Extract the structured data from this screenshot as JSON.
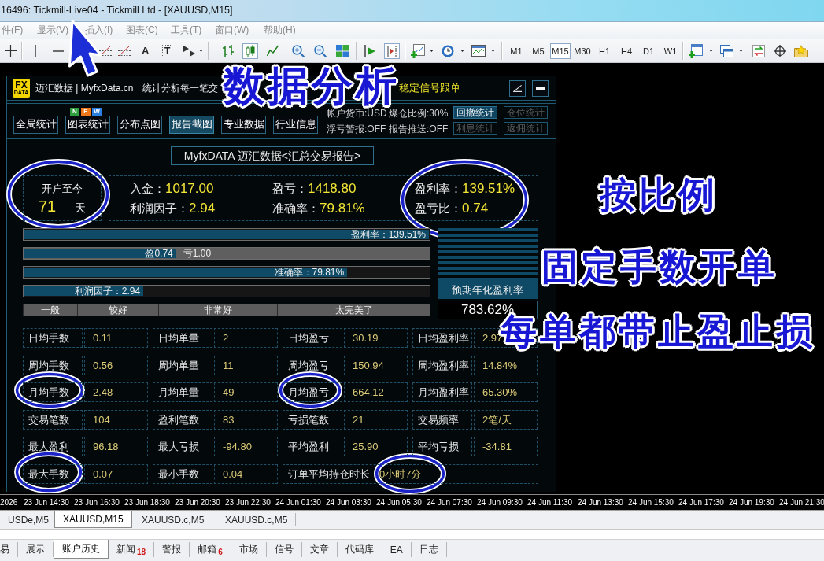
{
  "window": {
    "title": "16496: Tickmill-Live04 - Tickmill Ltd - [XAUUSD,M15]"
  },
  "menu": [
    {
      "label": "件(F)",
      "disabled": true
    },
    {
      "label": "显示(V)",
      "disabled": true
    },
    {
      "label": "插入(I)",
      "disabled": true
    },
    {
      "label": "图表(C)",
      "disabled": true
    },
    {
      "label": "工具(T)",
      "disabled": true
    },
    {
      "label": "窗口(W)",
      "disabled": true
    },
    {
      "label": "帮助(H)",
      "disabled": true
    }
  ],
  "toolbar": {
    "text_tool": "A",
    "label_tool": "T",
    "candlestick_on": true,
    "chart_shift_on": true,
    "timeframes": [
      {
        "label": "M1",
        "selected": false
      },
      {
        "label": "M5",
        "selected": false
      },
      {
        "label": "M15",
        "selected": true
      },
      {
        "label": "M30",
        "selected": false
      },
      {
        "label": "H1",
        "selected": false
      },
      {
        "label": "H4",
        "selected": false
      },
      {
        "label": "D1",
        "selected": false
      },
      {
        "label": "W1",
        "selected": false
      }
    ]
  },
  "panel": {
    "logo": {
      "top": "FX",
      "bottom": "DATA"
    },
    "brand": "迈汇数据 | MyfxData.cn",
    "tagline": "统计分析每一笔交",
    "signal_link": "稳定信号跟单",
    "nav_buttons": [
      {
        "label": "全局统计",
        "selected": false
      },
      {
        "label": "图表统计",
        "selected": false,
        "badge": [
          {
            "letter": "N",
            "color": "#2e9e3e"
          },
          {
            "letter": "E",
            "color": "#f07818"
          },
          {
            "letter": "W",
            "color": "#2b7fe0"
          }
        ]
      },
      {
        "label": "分布点图",
        "selected": false
      },
      {
        "label": "报告截图",
        "selected": true
      },
      {
        "label": "专业数据",
        "selected": false
      },
      {
        "label": "行业信息",
        "selected": false
      }
    ],
    "account_info": [
      "帐户货币:USD",
      "爆仓比例:30%",
      "浮亏警报:OFF",
      "报告推送:OFF"
    ],
    "side_buttons": [
      {
        "label": "回撤统计",
        "disabled": false
      },
      {
        "label": "仓位统计",
        "disabled": true
      },
      {
        "label": "利息统计",
        "disabled": true
      },
      {
        "label": "返佣统计",
        "disabled": true
      }
    ],
    "report_title": "MyfxDATA 迈汇数据<汇总交易报告>",
    "since_open": {
      "label": "开户至今",
      "value": "71",
      "unit": "天"
    },
    "summary": [
      {
        "label": "入金：",
        "value": "1017.00"
      },
      {
        "label": "盈亏：",
        "value": "1418.80"
      },
      {
        "label": "盈利率：",
        "value": "139.51%"
      },
      {
        "label": "利润因子：",
        "value": "2.94"
      },
      {
        "label": "准确率：",
        "value": "79.81%"
      },
      {
        "label": "盈亏比：",
        "value": "0.74"
      }
    ],
    "bars": [
      {
        "kind": "single",
        "label": "盈利率：139.51%",
        "level": 1
      },
      {
        "kind": "split",
        "label": "盈0.74",
        "rest_label": "亏1.00",
        "level": 0.375
      },
      {
        "kind": "single",
        "label": "准确率：79.81%",
        "level": 0.7981
      },
      {
        "kind": "single",
        "label": "利润因子：2.94",
        "level": 0.294
      }
    ],
    "rating_scale": [
      "一般",
      "较好",
      "非常好",
      "太完美了"
    ],
    "annual": {
      "label": "预期年化盈利率",
      "value": "783.62%"
    },
    "stats": [
      [
        {
          "label": "日均手数",
          "value": "0.11"
        },
        {
          "label": "日均单量",
          "value": "2"
        },
        {
          "label": "日均盈亏",
          "value": "30.19"
        },
        {
          "label": "日均盈利率",
          "value": "2.97"
        }
      ],
      [
        {
          "label": "周均手数",
          "value": "0.56"
        },
        {
          "label": "周均单量",
          "value": "11"
        },
        {
          "label": "周均盈亏",
          "value": "150.94"
        },
        {
          "label": "周均盈利率",
          "value": "14.84%"
        }
      ],
      [
        {
          "label": "月均手数",
          "value": "2.48"
        },
        {
          "label": "月均单量",
          "value": "49"
        },
        {
          "label": "月均盈亏",
          "value": "664.12"
        },
        {
          "label": "月均盈利率",
          "value": "65.30%"
        }
      ],
      [
        {
          "label": "交易笔数",
          "value": "104"
        },
        {
          "label": "盈利笔数",
          "value": "83"
        },
        {
          "label": "亏损笔数",
          "value": "21"
        },
        {
          "label": "交易频率",
          "value": "2笔/天"
        }
      ],
      [
        {
          "label": "最大盈利",
          "value": "96.18"
        },
        {
          "label": "最大亏损",
          "value": "-94.80"
        },
        {
          "label": "平均盈利",
          "value": "25.90"
        },
        {
          "label": "平均亏损",
          "value": "-34.81"
        }
      ],
      [
        {
          "label": "最大手数",
          "value": "0.07"
        },
        {
          "label": "最小手数",
          "value": "0.04"
        },
        {
          "label": "订单平均持仓时长",
          "value": "0小时7分"
        }
      ]
    ]
  },
  "annotations": {
    "headline": "数据分析",
    "notes": [
      "按比例",
      "固定手数开单",
      "每单都带止盈止损"
    ]
  },
  "time_axis": [
    "2026",
    "23 Jun 14:30",
    "23 Jun 16:30",
    "23 Jun 18:30",
    "23 Jun 20:30",
    "23 Jun 22:30",
    "24 Jun 01:30",
    "24 Jun 03:30",
    "24 Jun 05:30",
    "24 Jun 07:30",
    "24 Jun 09:30",
    "24 Jun 11:30",
    "24 Jun 13:30",
    "24 Jun 15:30",
    "24 Jun 17:30",
    "24 Jun 19:30",
    "24 Jun 21:30"
  ],
  "chart_tabs": [
    {
      "label": "USDe,M5",
      "selected": false
    },
    {
      "label": "XAUUSD,M15",
      "selected": true
    },
    {
      "label": "XAUUSD.c,M5",
      "selected": false
    },
    {
      "label": "XAUUSD.c,M5",
      "selected": false
    }
  ],
  "terminal_tabs": [
    {
      "label": "易",
      "selected": false
    },
    {
      "label": "展示",
      "selected": false
    },
    {
      "label": "账户历史",
      "selected": true
    },
    {
      "label": "新闻",
      "selected": false,
      "count": "18"
    },
    {
      "label": "警报",
      "selected": false
    },
    {
      "label": "邮箱",
      "selected": false,
      "count": "6"
    },
    {
      "label": "市场",
      "selected": false
    },
    {
      "label": "信号",
      "selected": false
    },
    {
      "label": "文章",
      "selected": false
    },
    {
      "label": "代码库",
      "selected": false
    },
    {
      "label": "EA",
      "selected": false
    },
    {
      "label": "日志",
      "selected": false
    }
  ]
}
